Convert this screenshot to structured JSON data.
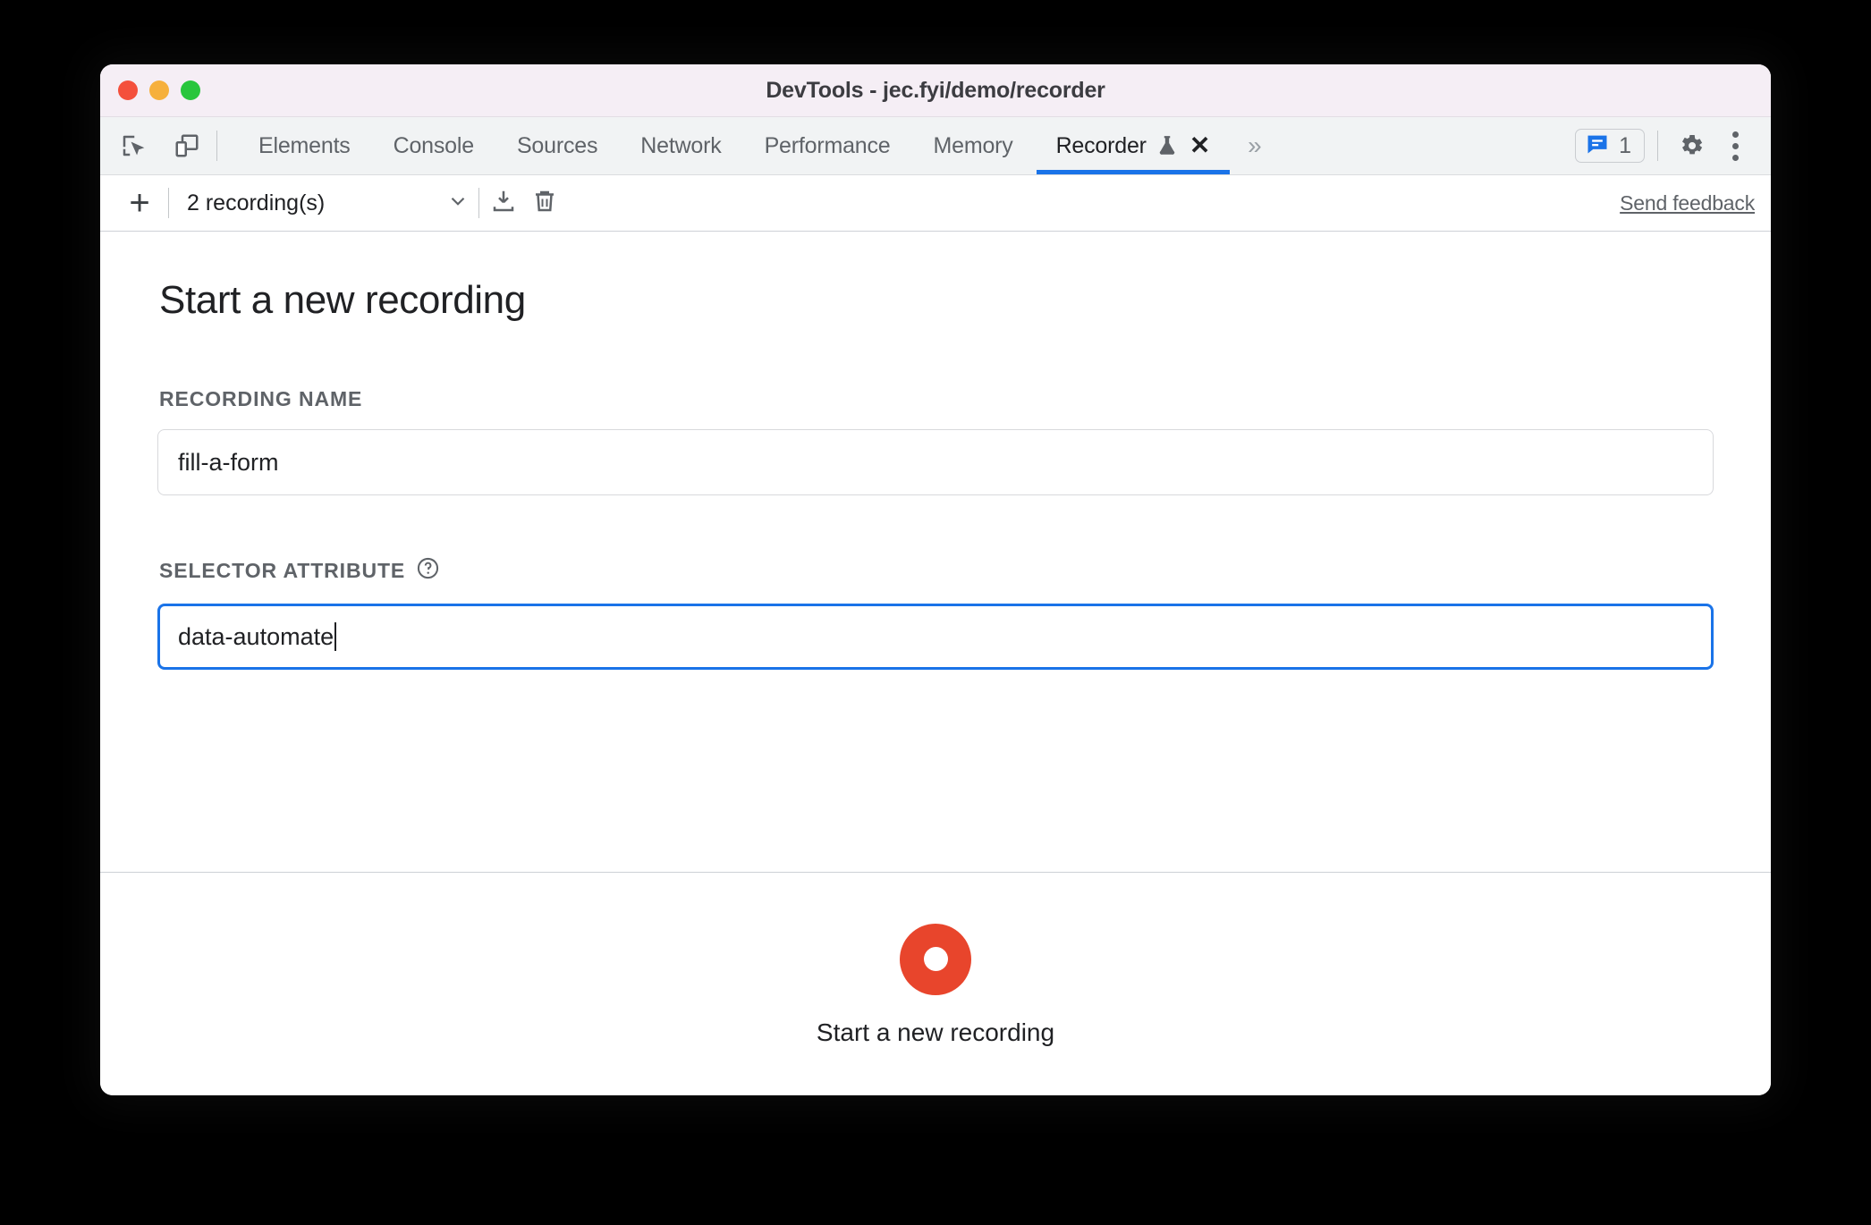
{
  "window": {
    "title": "DevTools - jec.fyi/demo/recorder",
    "traffic_lights": [
      {
        "name": "close",
        "color": "#f4503c"
      },
      {
        "name": "minimize",
        "color": "#f6b03c"
      },
      {
        "name": "zoom",
        "color": "#28c63c"
      }
    ]
  },
  "tabbar": {
    "inspect_icon": "inspect-element-icon",
    "device_icon": "device-toolbar-icon",
    "tabs": [
      {
        "label": "Elements",
        "active": false
      },
      {
        "label": "Console",
        "active": false
      },
      {
        "label": "Sources",
        "active": false
      },
      {
        "label": "Network",
        "active": false
      },
      {
        "label": "Performance",
        "active": false
      },
      {
        "label": "Memory",
        "active": false
      },
      {
        "label": "Recorder",
        "active": true,
        "experimental": true,
        "closable": true
      }
    ],
    "more_tabs_glyph": "»",
    "close_glyph": "✕",
    "message_count": "1",
    "settings_icon": "gear-icon",
    "menu_icon": "kebab-menu-icon",
    "accent_color": "#1a73e8"
  },
  "recorder_toolbar": {
    "add_glyph": "+",
    "recordings_label": "2 recording(s)",
    "dropdown_icon": "chevron-down-icon",
    "export_icon": "download-icon",
    "delete_icon": "trash-icon",
    "send_feedback_label": "Send feedback"
  },
  "main": {
    "title": "Start a new recording",
    "recording_name": {
      "label": "RECORDING NAME",
      "value": "fill-a-form"
    },
    "selector_attribute": {
      "label": "SELECTOR ATTRIBUTE",
      "help_icon": "help-circle-icon",
      "value": "data-automate",
      "focused": true
    }
  },
  "footer": {
    "record_button_label": "Start a new recording",
    "record_button_color": "#e8452c"
  }
}
